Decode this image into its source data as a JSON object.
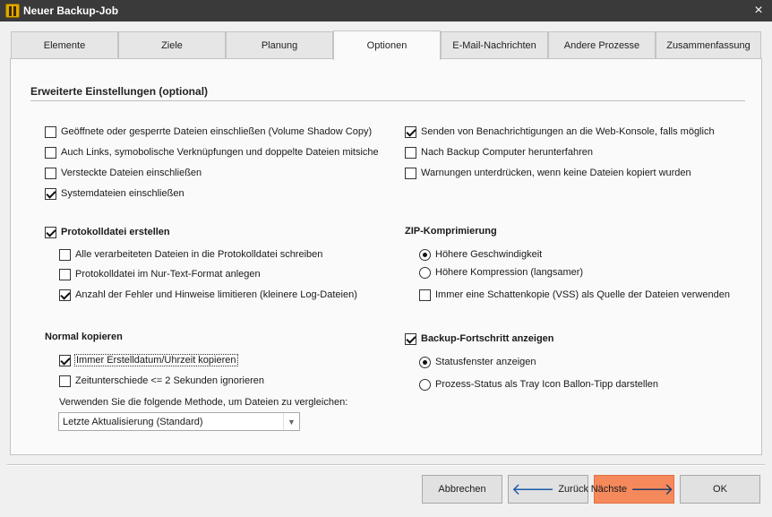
{
  "window": {
    "title": "Neuer Backup-Job",
    "close_icon": "×"
  },
  "tabs": [
    {
      "label": "Elemente"
    },
    {
      "label": "Ziele"
    },
    {
      "label": "Planung"
    },
    {
      "label": "Optionen",
      "active": true
    },
    {
      "label": "E-Mail-Nachrichten"
    },
    {
      "label": "Andere Prozesse"
    },
    {
      "label": "Zusammenfassung"
    }
  ],
  "section": {
    "title": "Erweiterte Einstellungen (optional)"
  },
  "left_options": [
    {
      "label": "Geöffnete oder gesperrte Dateien einschließen  (Volume Shadow Copy)",
      "checked": false
    },
    {
      "label": "Auch Links, symobolische Verknüpfungen und doppelte Dateien mitsiche",
      "checked": false
    },
    {
      "label": "Versteckte Dateien einschließen",
      "checked": false
    },
    {
      "label": "Systemdateien einschließen",
      "checked": true
    }
  ],
  "right_options": [
    {
      "label": "Senden von Benachrichtigungen an die Web-Konsole, falls möglich",
      "checked": true
    },
    {
      "label": "Nach Backup Computer herunterfahren",
      "checked": false
    },
    {
      "label": "Warnungen unterdrücken, wenn keine Dateien kopiert wurden",
      "checked": false
    }
  ],
  "logfile": {
    "label": "Protokolldatei erstellen",
    "checked": true,
    "options": [
      {
        "label": "Alle verarbeiteten Dateien in die Protokolldatei schreiben",
        "checked": false
      },
      {
        "label": "Protokolldatei im Nur-Text-Format anlegen",
        "checked": false
      },
      {
        "label": "Anzahl der Fehler und Hinweise limitieren (kleinere Log-Dateien)",
        "checked": true
      }
    ]
  },
  "zip": {
    "label": "ZIP-Komprimierung",
    "radios": [
      {
        "label": "Höhere Geschwindigkeit",
        "checked": true
      },
      {
        "label": "Höhere Kompression (langsamer)",
        "checked": false
      }
    ],
    "vss": {
      "label": "Immer eine Schattenkopie (VSS) als Quelle der Dateien verwenden",
      "checked": false
    }
  },
  "normal_copy": {
    "label": "Normal kopieren",
    "options": [
      {
        "label": "Immer Erstelldatum/Uhrzeit kopieren",
        "checked": true
      },
      {
        "label": "Zeitunterschiede <= 2 Sekunden ignorieren",
        "checked": false
      }
    ],
    "compare_label": "Verwenden Sie die folgende Methode, um Dateien zu vergleichen:",
    "compare_value": "Letzte Aktualisierung (Standard)"
  },
  "progress": {
    "label": "Backup-Fortschritt anzeigen",
    "checked": true,
    "radios": [
      {
        "label": "Statusfenster anzeigen",
        "checked": true
      },
      {
        "label": "Prozess-Status als Tray Icon Ballon-Tipp darstellen",
        "checked": false
      }
    ]
  },
  "buttons": {
    "cancel": "Abbrechen",
    "back": "Zurück",
    "next": "Nächste",
    "ok": "OK",
    "back_arrow": "🡐",
    "next_arrow": "🡒"
  }
}
